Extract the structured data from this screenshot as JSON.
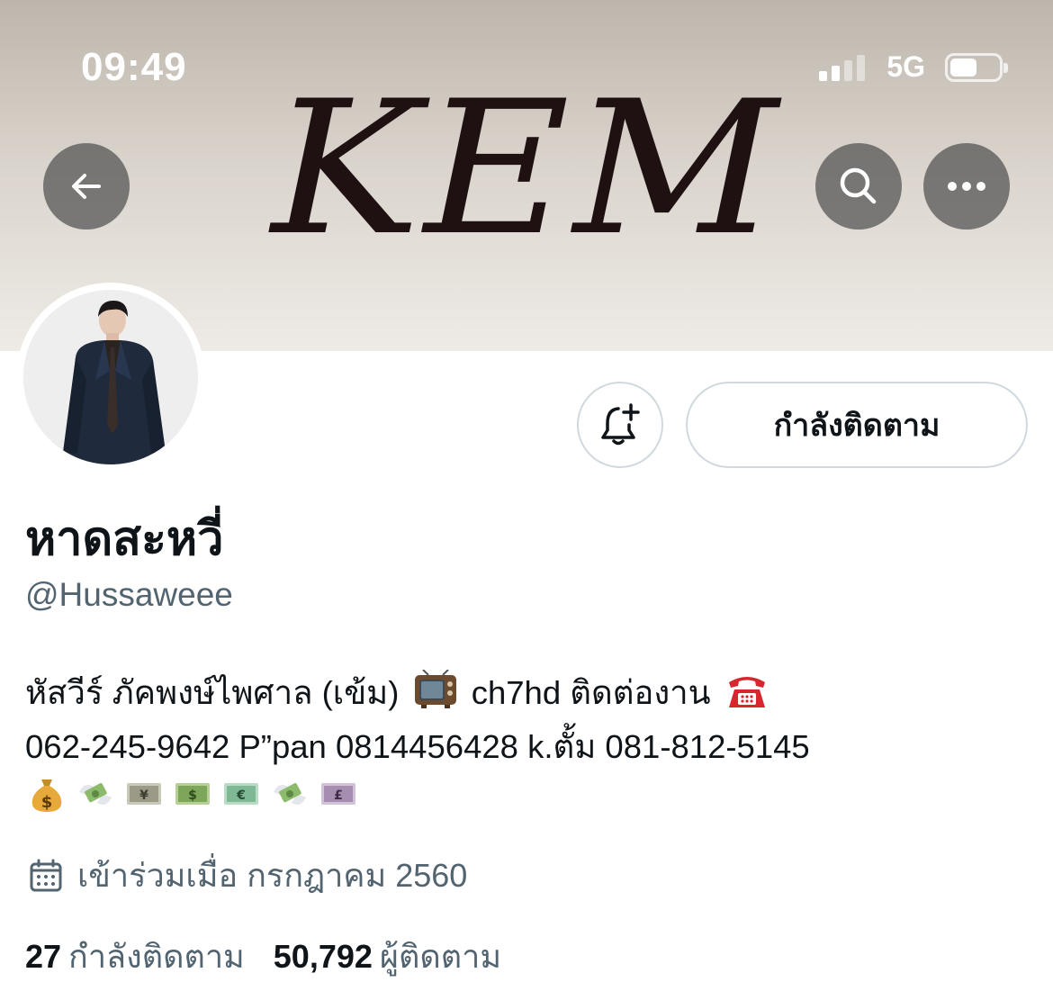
{
  "status_bar": {
    "time": "09:49",
    "network": "5G",
    "battery_level": 0.55
  },
  "header": {
    "banner_text": "KEM",
    "back_icon": "arrow-left-icon",
    "search_icon": "search-icon",
    "more_icon": "more-horizontal-icon"
  },
  "profile": {
    "display_name": "หาดสะหวี่",
    "handle": "@Hussaweee",
    "follow_button_label": "กำลังติดตาม",
    "notify_icon": "bell-plus-icon",
    "bio": {
      "line1_part1": "หัสวีร์ ภัคพงษ์ไพศาล (เข้ม)",
      "line1_part2": "ch7hd ติดต่องาน",
      "line2": "062-245-9642 P”pan 0814456428 k.ตั้ม 081-812-5145",
      "line1_emojis": [
        "television-icon",
        "telephone-icon"
      ],
      "line3_emojis": [
        "money-bag-icon",
        "money-with-wings-icon",
        "yen-banknote-icon",
        "dollar-banknote-icon",
        "euro-banknote-icon",
        "money-with-wings-icon",
        "pound-banknote-icon"
      ]
    },
    "joined_text": "เข้าร่วมเมื่อ กรกฎาคม 2560",
    "following_count": "27",
    "following_label": "กำลังติดตาม",
    "followers_count": "50,792",
    "followers_label": "ผู้ติดตาม"
  },
  "colors": {
    "primary_text": "#0f1419",
    "secondary_text": "#536471",
    "border": "#cfd9de",
    "banner_logo": "#1f1012"
  }
}
